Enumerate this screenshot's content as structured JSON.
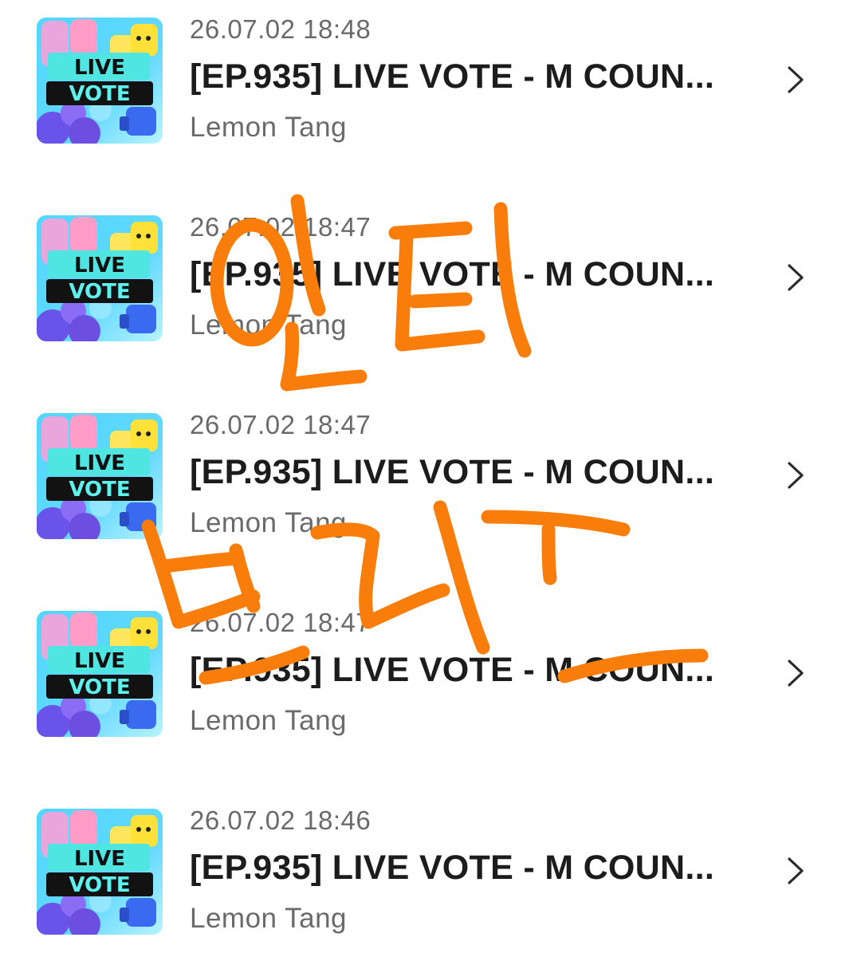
{
  "items": [
    {
      "thumb_text_1": "LIVE",
      "thumb_text_2": "VOTE",
      "date": "26.07.02 18:48",
      "title": "[EP.935] LIVE VOTE - M COUN...",
      "author": "Lemon Tang"
    },
    {
      "thumb_text_1": "LIVE",
      "thumb_text_2": "VOTE",
      "date": "26.07.02 18:47",
      "title": "[EP.935] LIVE VOTE - M COUN...",
      "author": "Lemon Tang"
    },
    {
      "thumb_text_1": "LIVE",
      "thumb_text_2": "VOTE",
      "date": "26.07.02 18:47",
      "title": "[EP.935] LIVE VOTE - M COUN...",
      "author": "Lemon Tang"
    },
    {
      "thumb_text_1": "LIVE",
      "thumb_text_2": "VOTE",
      "date": "26.07.02 18:47",
      "title": "[EP.935] LIVE VOTE - M COUN...",
      "author": "Lemon Tang"
    },
    {
      "thumb_text_1": "LIVE",
      "thumb_text_2": "VOTE",
      "date": "26.07.02 18:46",
      "title": "[EP.935] LIVE VOTE - M COUN...",
      "author": "Lemon Tang"
    }
  ],
  "icons": {
    "row_arrow": "chevron-right-icon"
  },
  "colors": {
    "scribble": "#f97d0b",
    "title": "#1c1c1c",
    "meta": "#6a6a6a"
  }
}
